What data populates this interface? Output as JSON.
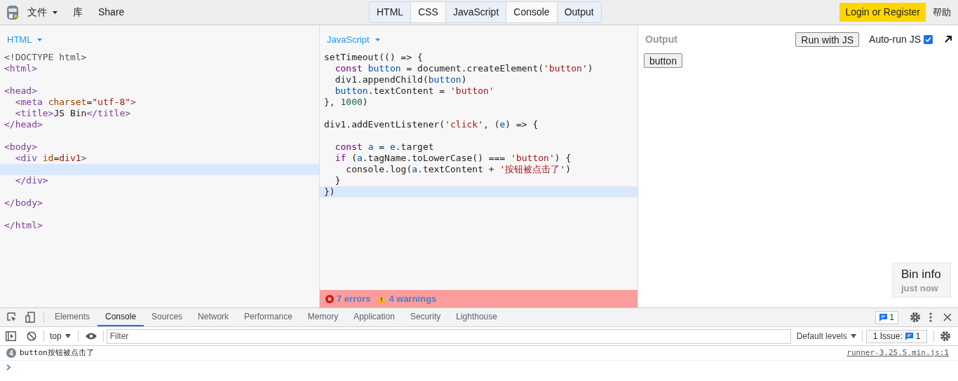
{
  "topbar": {
    "menus": [
      {
        "label": "文件",
        "dropdown": true
      },
      {
        "label": "库",
        "dropdown": false
      },
      {
        "label": "Share",
        "dropdown": false
      }
    ],
    "panel_tabs": [
      {
        "label": "HTML",
        "selected": true
      },
      {
        "label": "CSS",
        "selected": false
      },
      {
        "label": "JavaScript",
        "selected": true
      },
      {
        "label": "Console",
        "selected": false
      },
      {
        "label": "Output",
        "selected": true
      }
    ],
    "login": "Login or Register",
    "help": "帮助"
  },
  "html_panel": {
    "title": "HTML",
    "lines": [
      {
        "kind": "code",
        "active": false,
        "tokens": [
          {
            "text": "<!DOCTYPE html>",
            "kind": "meta"
          }
        ]
      },
      {
        "kind": "code",
        "active": false,
        "tokens": [
          {
            "text": "<html>",
            "kind": "tag"
          }
        ]
      },
      {
        "kind": "blank",
        "active": false
      },
      {
        "kind": "code",
        "active": false,
        "tokens": [
          {
            "text": "<head>",
            "kind": "tag"
          }
        ]
      },
      {
        "kind": "code",
        "active": false,
        "tokens": [
          {
            "text": "  <meta ",
            "kind": "tag"
          },
          {
            "text": "charset",
            "kind": "attr"
          },
          {
            "text": "=",
            "kind": "plain"
          },
          {
            "text": "\"utf-8\"",
            "kind": "string"
          },
          {
            "text": ">",
            "kind": "tag"
          }
        ]
      },
      {
        "kind": "code",
        "active": false,
        "tokens": [
          {
            "text": "  <title>",
            "kind": "tag"
          },
          {
            "text": "JS Bin",
            "kind": "plain"
          },
          {
            "text": "</title>",
            "kind": "tag"
          }
        ]
      },
      {
        "kind": "code",
        "active": false,
        "tokens": [
          {
            "text": "</head>",
            "kind": "tag"
          }
        ]
      },
      {
        "kind": "blank",
        "active": false
      },
      {
        "kind": "code",
        "active": false,
        "tokens": [
          {
            "text": "<body>",
            "kind": "tag"
          }
        ]
      },
      {
        "kind": "code",
        "active": false,
        "tokens": [
          {
            "text": "  <div ",
            "kind": "tag"
          },
          {
            "text": "id",
            "kind": "attr"
          },
          {
            "text": "=",
            "kind": "plain"
          },
          {
            "text": "div1",
            "kind": "string"
          },
          {
            "text": ">",
            "kind": "tag"
          }
        ]
      },
      {
        "kind": "blank",
        "active": true
      },
      {
        "kind": "code",
        "active": false,
        "tokens": [
          {
            "text": "  </div>",
            "kind": "tag"
          }
        ]
      },
      {
        "kind": "blank",
        "active": false
      },
      {
        "kind": "code",
        "active": false,
        "tokens": [
          {
            "text": "</body>",
            "kind": "tag"
          }
        ]
      },
      {
        "kind": "blank",
        "active": false
      },
      {
        "kind": "code",
        "active": false,
        "tokens": [
          {
            "text": "</html>",
            "kind": "tag"
          }
        ]
      }
    ]
  },
  "js_panel": {
    "title": "JavaScript",
    "lines": [
      {
        "kind": "code",
        "active": false,
        "tokens": [
          {
            "text": "setTimeout(() => {",
            "kind": "plain"
          }
        ]
      },
      {
        "kind": "code",
        "active": false,
        "tokens": [
          {
            "text": "  const ",
            "kind": "keyword"
          },
          {
            "text": "button",
            "kind": "variable"
          },
          {
            "text": " = document.createElement(",
            "kind": "plain"
          },
          {
            "text": "'button'",
            "kind": "string"
          },
          {
            "text": ")",
            "kind": "plain"
          }
        ]
      },
      {
        "kind": "code",
        "active": false,
        "tokens": [
          {
            "text": "  div1.appendChild(",
            "kind": "plain"
          },
          {
            "text": "button",
            "kind": "variable"
          },
          {
            "text": ")",
            "kind": "plain"
          }
        ]
      },
      {
        "kind": "code",
        "active": false,
        "tokens": [
          {
            "text": "  button",
            "kind": "variable"
          },
          {
            "text": ".textContent = ",
            "kind": "plain"
          },
          {
            "text": "'button'",
            "kind": "string"
          }
        ]
      },
      {
        "kind": "code",
        "active": false,
        "tokens": [
          {
            "text": "}, ",
            "kind": "plain"
          },
          {
            "text": "1000",
            "kind": "number"
          },
          {
            "text": ")",
            "kind": "plain"
          }
        ]
      },
      {
        "kind": "blank",
        "active": false
      },
      {
        "kind": "code",
        "active": false,
        "tokens": [
          {
            "text": "div1.addEventListener(",
            "kind": "plain"
          },
          {
            "text": "'click'",
            "kind": "string"
          },
          {
            "text": ", (",
            "kind": "plain"
          },
          {
            "text": "e",
            "kind": "variable"
          },
          {
            "text": ") => {",
            "kind": "plain"
          }
        ]
      },
      {
        "kind": "blank",
        "active": false
      },
      {
        "kind": "code",
        "active": false,
        "tokens": [
          {
            "text": "  const ",
            "kind": "keyword"
          },
          {
            "text": "a",
            "kind": "variable"
          },
          {
            "text": " = ",
            "kind": "plain"
          },
          {
            "text": "e",
            "kind": "variable"
          },
          {
            "text": ".target",
            "kind": "plain"
          }
        ]
      },
      {
        "kind": "code",
        "active": false,
        "tokens": [
          {
            "text": "  if",
            "kind": "keyword"
          },
          {
            "text": " (",
            "kind": "plain"
          },
          {
            "text": "a",
            "kind": "variable"
          },
          {
            "text": ".tagName.toLowerCase() === ",
            "kind": "plain"
          },
          {
            "text": "'button'",
            "kind": "string"
          },
          {
            "text": ") {",
            "kind": "plain"
          }
        ]
      },
      {
        "kind": "code",
        "active": false,
        "tokens": [
          {
            "text": "    console.log(",
            "kind": "plain"
          },
          {
            "text": "a",
            "kind": "variable"
          },
          {
            "text": ".textContent + ",
            "kind": "plain"
          },
          {
            "text": "'按钮被点击了'",
            "kind": "string"
          },
          {
            "text": ")",
            "kind": "plain"
          }
        ]
      },
      {
        "kind": "code",
        "active": false,
        "tokens": [
          {
            "text": "  }",
            "kind": "plain"
          }
        ]
      },
      {
        "kind": "code",
        "active": true,
        "tokens": [
          {
            "text": "})",
            "kind": "plain"
          }
        ]
      }
    ],
    "errors": "7 errors",
    "warnings": "4 warnings"
  },
  "output_panel": {
    "title": "Output",
    "run_button": "Run with JS",
    "autorun": {
      "label": "Auto-run JS",
      "checked": true
    },
    "rendered_button": "button",
    "bin_info": {
      "title": "Bin info",
      "time": "just now"
    }
  },
  "devtools": {
    "tabs": [
      {
        "label": "Elements",
        "selected": false
      },
      {
        "label": "Console",
        "selected": true
      },
      {
        "label": "Sources",
        "selected": false
      },
      {
        "label": "Network",
        "selected": false
      },
      {
        "label": "Performance",
        "selected": false
      },
      {
        "label": "Memory",
        "selected": false
      },
      {
        "label": "Application",
        "selected": false
      },
      {
        "label": "Security",
        "selected": false
      },
      {
        "label": "Lighthouse",
        "selected": false
      }
    ],
    "issues_count": "1",
    "context": "top",
    "filter_placeholder": "Filter",
    "levels": "Default levels",
    "issue_label": "1 Issue:",
    "issue_count": "1",
    "messages": [
      {
        "count": "4",
        "text": "button按钮被点击了",
        "source": "runner-3.25.5.min.js:1"
      }
    ]
  }
}
